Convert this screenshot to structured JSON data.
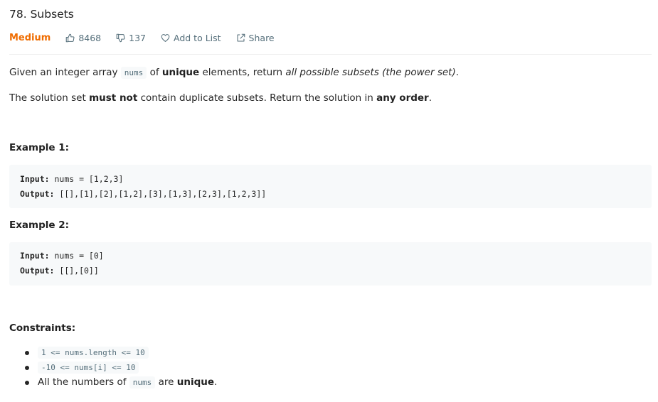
{
  "problem": {
    "title": "78. Subsets",
    "difficulty": "Medium",
    "likes": "8468",
    "dislikes": "137",
    "add_to_list": "Add to List",
    "share": "Share"
  },
  "description": {
    "p1": {
      "t1": "Given an integer array ",
      "code": "nums",
      "t2": " of ",
      "bold": "unique",
      "t3": " elements, return ",
      "italic": "all possible subsets (the power set)",
      "t4": "."
    },
    "p2": {
      "t1": "The solution set ",
      "bold1": "must not",
      "t2": " contain duplicate subsets. Return the solution in ",
      "bold2": "any order",
      "t3": "."
    }
  },
  "examples": [
    {
      "heading": "Example 1:",
      "input_label": "Input:",
      "input_value": " nums = [1,2,3]",
      "output_label": "Output:",
      "output_value": " [[],[1],[2],[1,2],[3],[1,3],[2,3],[1,2,3]]"
    },
    {
      "heading": "Example 2:",
      "input_label": "Input:",
      "input_value": " nums = [0]",
      "output_label": "Output:",
      "output_value": " [[],[0]]"
    }
  ],
  "constraints": {
    "heading": "Constraints:",
    "c1": "1 <= nums.length <= 10",
    "c2": "-10 <= nums[i] <= 10",
    "c3": {
      "t1": "All the numbers of ",
      "code": "nums",
      "t2": " are ",
      "bold": "unique",
      "t3": "."
    }
  },
  "colors": {
    "difficulty": "#ef6c00",
    "meta": "#546e7a",
    "code_bg": "#f7f9fa"
  },
  "icons": [
    "thumbs-up-icon",
    "thumbs-down-icon",
    "heart-icon",
    "share-icon"
  ]
}
